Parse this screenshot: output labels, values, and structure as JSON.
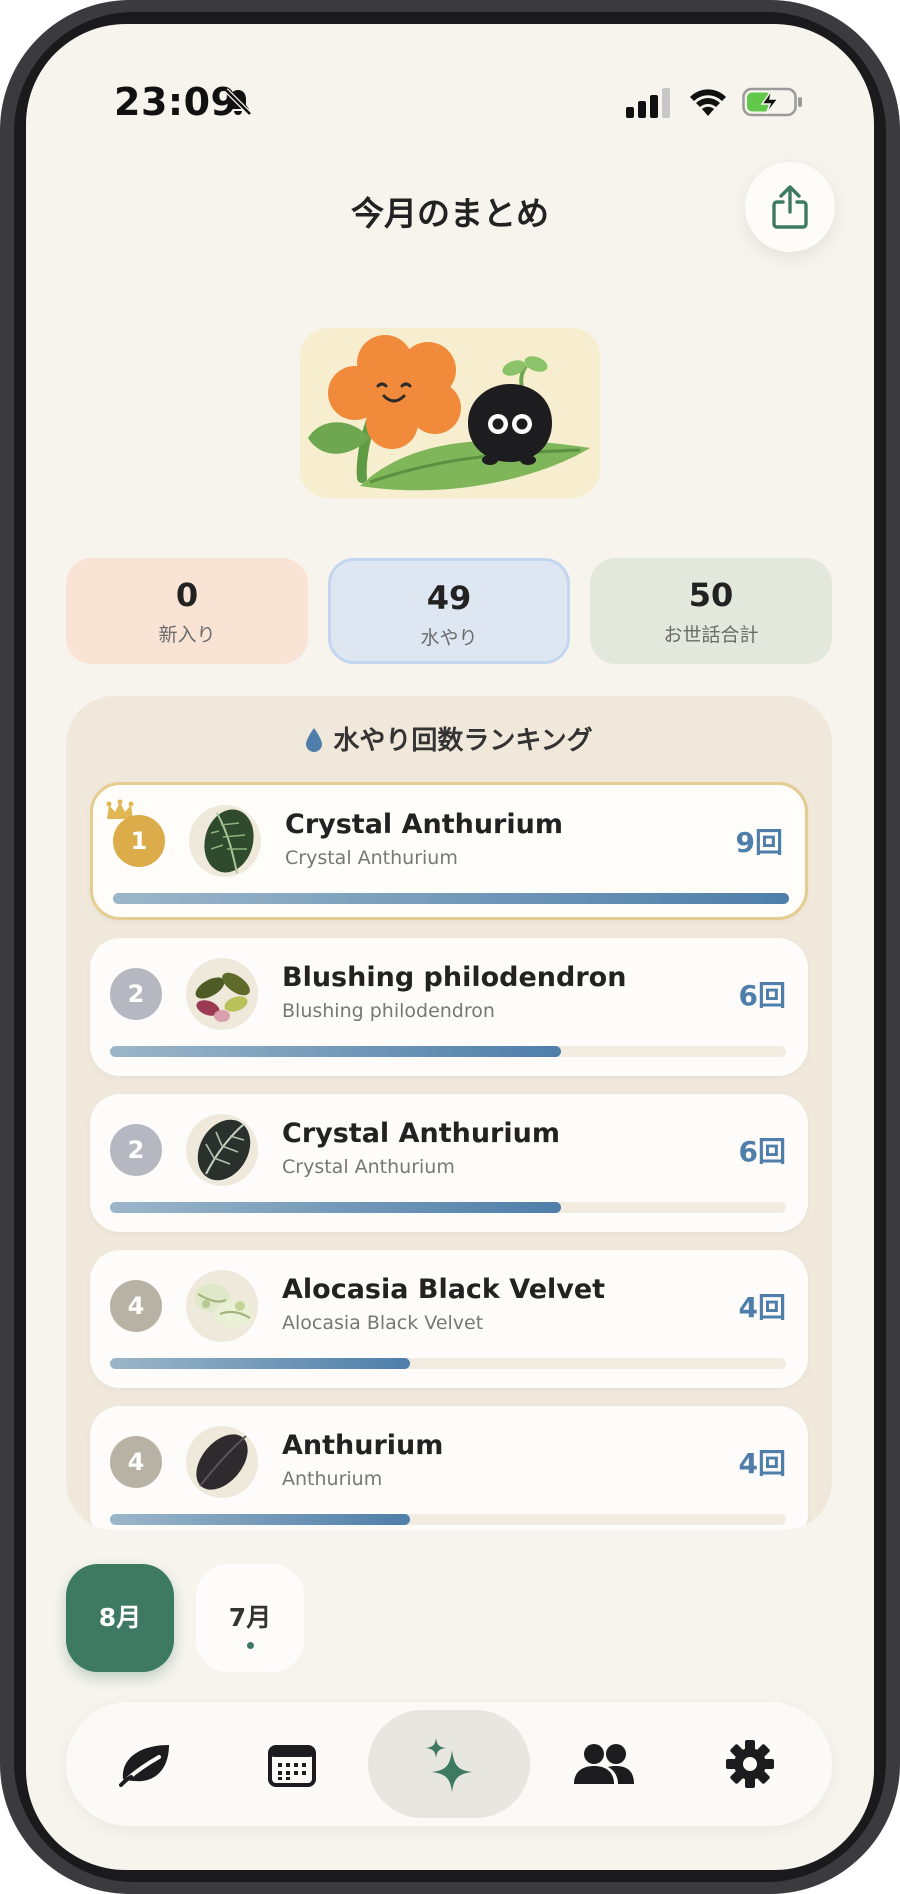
{
  "status_bar": {
    "time": "23:09"
  },
  "header": {
    "title": "今月のまとめ"
  },
  "stats": [
    {
      "value": "0",
      "label": "新入り"
    },
    {
      "value": "49",
      "label": "水やり"
    },
    {
      "value": "50",
      "label": "お世話合計"
    }
  ],
  "ranking": {
    "title": "水やり回数ランキング",
    "items": [
      {
        "rank": "1",
        "name": "Crystal Anthurium",
        "sub": "Crystal Anthurium",
        "count": "9回",
        "fraction": 1.0
      },
      {
        "rank": "2",
        "name": "Blushing philodendron",
        "sub": "Blushing philodendron",
        "count": "6回",
        "fraction": 0.667
      },
      {
        "rank": "2",
        "name": "Crystal Anthurium",
        "sub": "Crystal Anthurium",
        "count": "6回",
        "fraction": 0.667
      },
      {
        "rank": "4",
        "name": "Alocasia Black Velvet",
        "sub": "Alocasia Black Velvet",
        "count": "4回",
        "fraction": 0.444
      },
      {
        "rank": "4",
        "name": "Anthurium",
        "sub": "Anthurium",
        "count": "4回",
        "fraction": 0.444
      }
    ]
  },
  "months": [
    {
      "label": "8月",
      "active": true
    },
    {
      "label": "7月",
      "active": false
    }
  ],
  "tabbar": {
    "items": [
      {
        "icon": "leaf-icon"
      },
      {
        "icon": "calendar-icon"
      },
      {
        "icon": "sparkle-icon",
        "active": true
      },
      {
        "icon": "people-icon"
      },
      {
        "icon": "gear-icon"
      }
    ]
  },
  "colors": {
    "accent": "#3e7962",
    "count": "#4e7ea9",
    "gold": "#dcac4a"
  }
}
